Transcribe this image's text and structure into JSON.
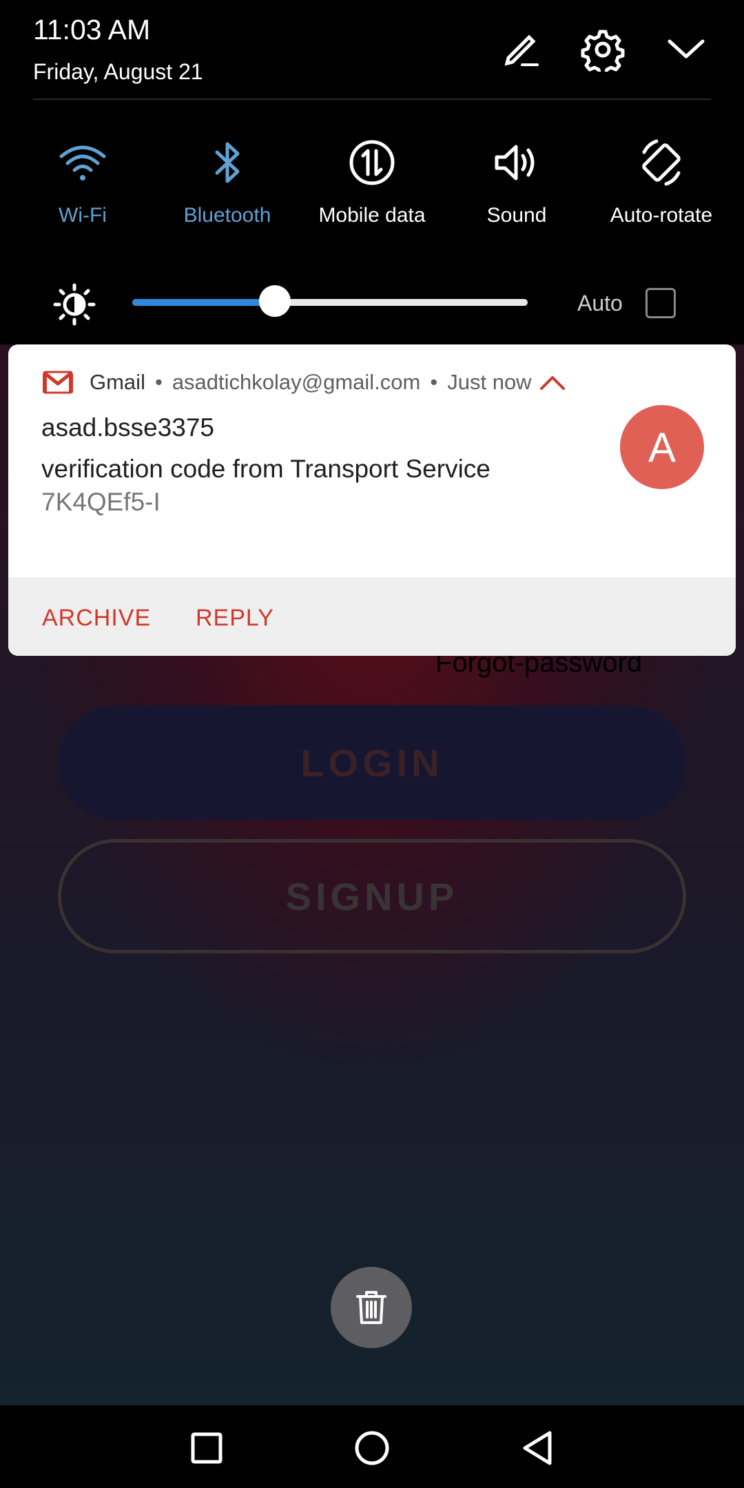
{
  "status": {
    "time": "11:03 AM",
    "date": "Friday, August 21"
  },
  "header_icons": [
    "edit-icon",
    "gear-icon",
    "chevron-down-icon"
  ],
  "tiles": [
    {
      "label": "Wi-Fi",
      "icon": "wifi-icon",
      "active": true
    },
    {
      "label": "Bluetooth",
      "icon": "bluetooth-icon",
      "active": true
    },
    {
      "label": "Mobile data",
      "icon": "mobile-data-icon",
      "active": false
    },
    {
      "label": "Sound",
      "icon": "sound-icon",
      "active": false
    },
    {
      "label": "Auto-rotate",
      "icon": "auto-rotate-icon",
      "active": false
    }
  ],
  "brightness": {
    "level": 0.36,
    "auto_label": "Auto",
    "auto_checked": false
  },
  "notification": {
    "app": "Gmail",
    "account": "asadtichkolay@gmail.com",
    "time": "Just now",
    "title": "asad.bsse3375",
    "body": "verification code from Transport Service",
    "code": "7K4QEf5-I",
    "avatar_letter": "A",
    "actions": [
      "ARCHIVE",
      "REPLY"
    ]
  },
  "app_behind": {
    "forgot_label": "Forgot-password",
    "login_label": "LOGIN",
    "signup_label": "SIGNUP"
  },
  "colors": {
    "accent_blue": "#5fa2d3",
    "slider_blue": "#2f88de",
    "gmail_red": "#d0382b",
    "avatar": "#e06055"
  }
}
